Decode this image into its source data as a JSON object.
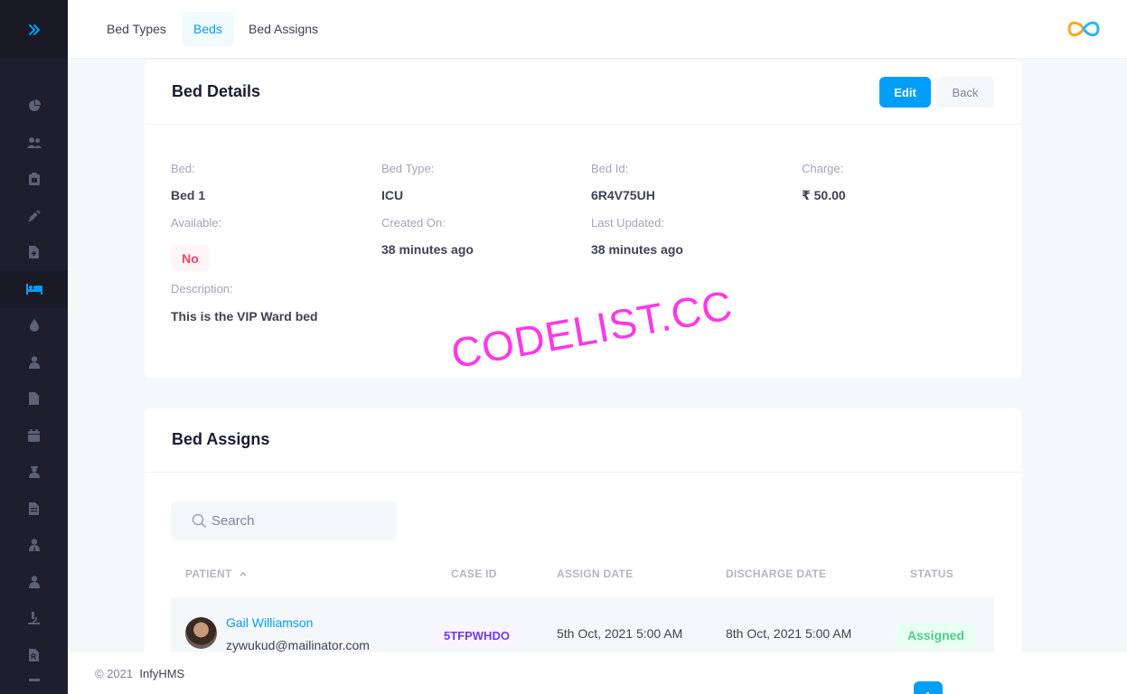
{
  "header": {
    "tabs": [
      {
        "label": "Bed Types",
        "active": false
      },
      {
        "label": "Beds",
        "active": true
      },
      {
        "label": "Bed Assigns",
        "active": false
      }
    ]
  },
  "sidebar": {
    "toggle_icon": "double-chevron-right-icon",
    "items": [
      {
        "icon": "chart-pie-icon"
      },
      {
        "icon": "users-icon"
      },
      {
        "icon": "clipboard-icon"
      },
      {
        "icon": "syringe-icon"
      },
      {
        "icon": "file-medical-icon"
      },
      {
        "icon": "bed-icon",
        "active": true
      },
      {
        "icon": "blood-drop-icon"
      },
      {
        "icon": "user-md-icon"
      },
      {
        "icon": "file-icon"
      },
      {
        "icon": "calendar-icon"
      },
      {
        "icon": "user-nurse-icon"
      },
      {
        "icon": "file-invoice-icon"
      },
      {
        "icon": "user-tie-icon"
      },
      {
        "icon": "user-icon"
      },
      {
        "icon": "microscope-icon"
      },
      {
        "icon": "file-prescription-icon"
      }
    ]
  },
  "bed_details": {
    "title": "Bed Details",
    "edit_label": "Edit",
    "back_label": "Back",
    "bed_label": "Bed:",
    "bed_value": "Bed 1",
    "type_label": "Bed Type:",
    "type_value": "ICU",
    "id_label": "Bed Id:",
    "id_value": "6R4V75UH",
    "charge_label": "Charge:",
    "charge_value": "₹ 50.00",
    "available_label": "Available:",
    "available_value": "No",
    "created_label": "Created On:",
    "created_value": "38 minutes ago",
    "updated_label": "Last Updated:",
    "updated_value": "38 minutes ago",
    "description_label": "Description:",
    "description_value": "This is the VIP Ward bed"
  },
  "bed_assigns": {
    "title": "Bed Assigns",
    "search_placeholder": "Search",
    "columns": [
      "PATIENT",
      "CASE ID",
      "ASSIGN DATE",
      "DISCHARGE DATE",
      "STATUS"
    ],
    "rows": [
      {
        "patient_name": "Gail Williamson",
        "patient_email": "zywukud@mailinator.com",
        "case_id": "5TFPWHDO",
        "assign_date": "5th Oct, 2021 5:00 AM",
        "discharge_date": "8th Oct, 2021 5:00 AM",
        "status": "Assigned"
      }
    ]
  },
  "footer": {
    "copyright": "© 2021",
    "brand": "InfyHMS",
    "page": "1"
  },
  "watermark": "CODELIST.CC",
  "colors": {
    "primary": "#009ef7",
    "sidebar": "#1e1e2d",
    "danger": "#f1416c",
    "success": "#50cd89",
    "info": "#7239ea"
  }
}
